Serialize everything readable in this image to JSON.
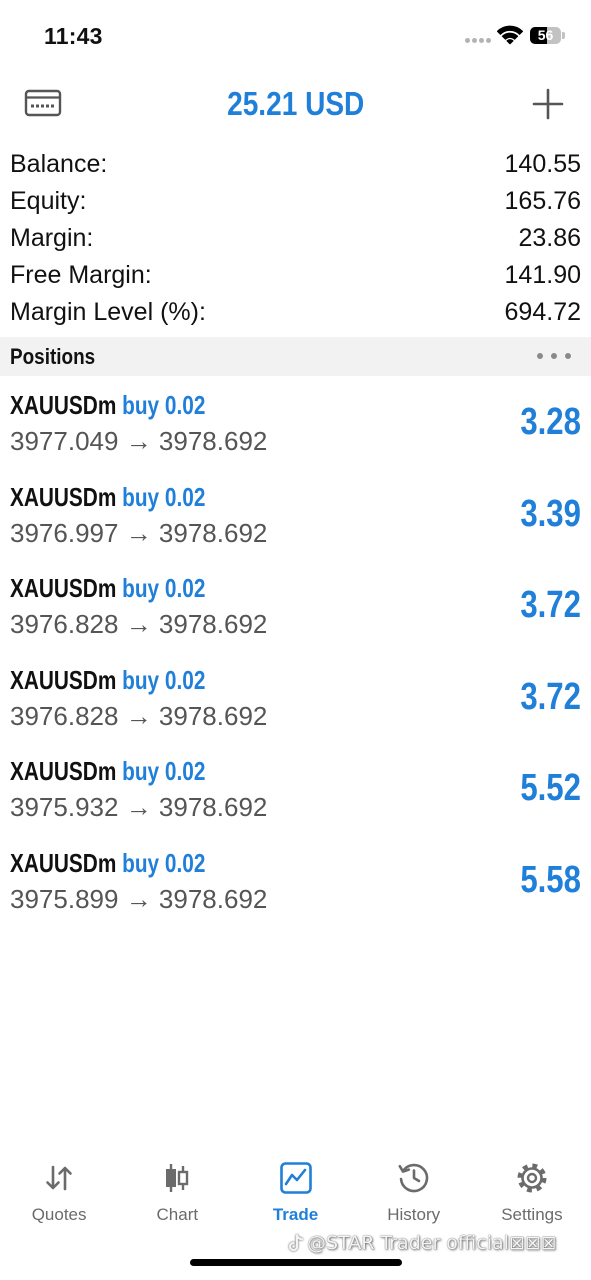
{
  "status_bar": {
    "time": "11:43",
    "battery_level": "56",
    "icons": {
      "signal": "cellular-signal-dots-icon",
      "wifi": "wifi-icon",
      "battery": "battery-icon"
    }
  },
  "header": {
    "title": "25.21 USD",
    "left_icon": "accounts-card-icon",
    "right_icon": "plus-icon"
  },
  "summary": [
    {
      "label": "Balance:",
      "value": "140.55"
    },
    {
      "label": "Equity:",
      "value": "165.76"
    },
    {
      "label": "Margin:",
      "value": "23.86"
    },
    {
      "label": "Free Margin:",
      "value": "141.90"
    },
    {
      "label": "Margin Level (%):",
      "value": "694.72"
    }
  ],
  "positions_section": {
    "title": "Positions",
    "more_icon": "ellipsis-icon",
    "price_arrow": "→"
  },
  "positions": [
    {
      "symbol": "XAUUSDm",
      "side": "buy",
      "volume": "0.02",
      "open_price": "3977.049",
      "current_price": "3978.692",
      "profit": "3.28"
    },
    {
      "symbol": "XAUUSDm",
      "side": "buy",
      "volume": "0.02",
      "open_price": "3976.997",
      "current_price": "3978.692",
      "profit": "3.39"
    },
    {
      "symbol": "XAUUSDm",
      "side": "buy",
      "volume": "0.02",
      "open_price": "3976.828",
      "current_price": "3978.692",
      "profit": "3.72"
    },
    {
      "symbol": "XAUUSDm",
      "side": "buy",
      "volume": "0.02",
      "open_price": "3976.828",
      "current_price": "3978.692",
      "profit": "3.72"
    },
    {
      "symbol": "XAUUSDm",
      "side": "buy",
      "volume": "0.02",
      "open_price": "3975.932",
      "current_price": "3978.692",
      "profit": "5.52"
    },
    {
      "symbol": "XAUUSDm",
      "side": "buy",
      "volume": "0.02",
      "open_price": "3975.899",
      "current_price": "3978.692",
      "profit": "5.58"
    }
  ],
  "tab_bar": {
    "tabs": [
      {
        "label": "Quotes",
        "icon": "quotes-arrows-icon",
        "active": false
      },
      {
        "label": "Chart",
        "icon": "candlestick-chart-icon",
        "active": false
      },
      {
        "label": "Trade",
        "icon": "trade-chart-icon",
        "active": true
      },
      {
        "label": "History",
        "icon": "history-clock-icon",
        "active": false
      },
      {
        "label": "Settings",
        "icon": "gear-icon",
        "active": false
      }
    ]
  },
  "watermark": {
    "text": "@STAR Trader official⊠⊠⊠",
    "logo_icon": "tiktok-logo-icon"
  },
  "colors": {
    "accent": "#1f7fd9",
    "text": "#111111",
    "secondary_text": "#555555",
    "tab_inactive": "#6b6b6b",
    "section_background": "#f2f2f2"
  }
}
